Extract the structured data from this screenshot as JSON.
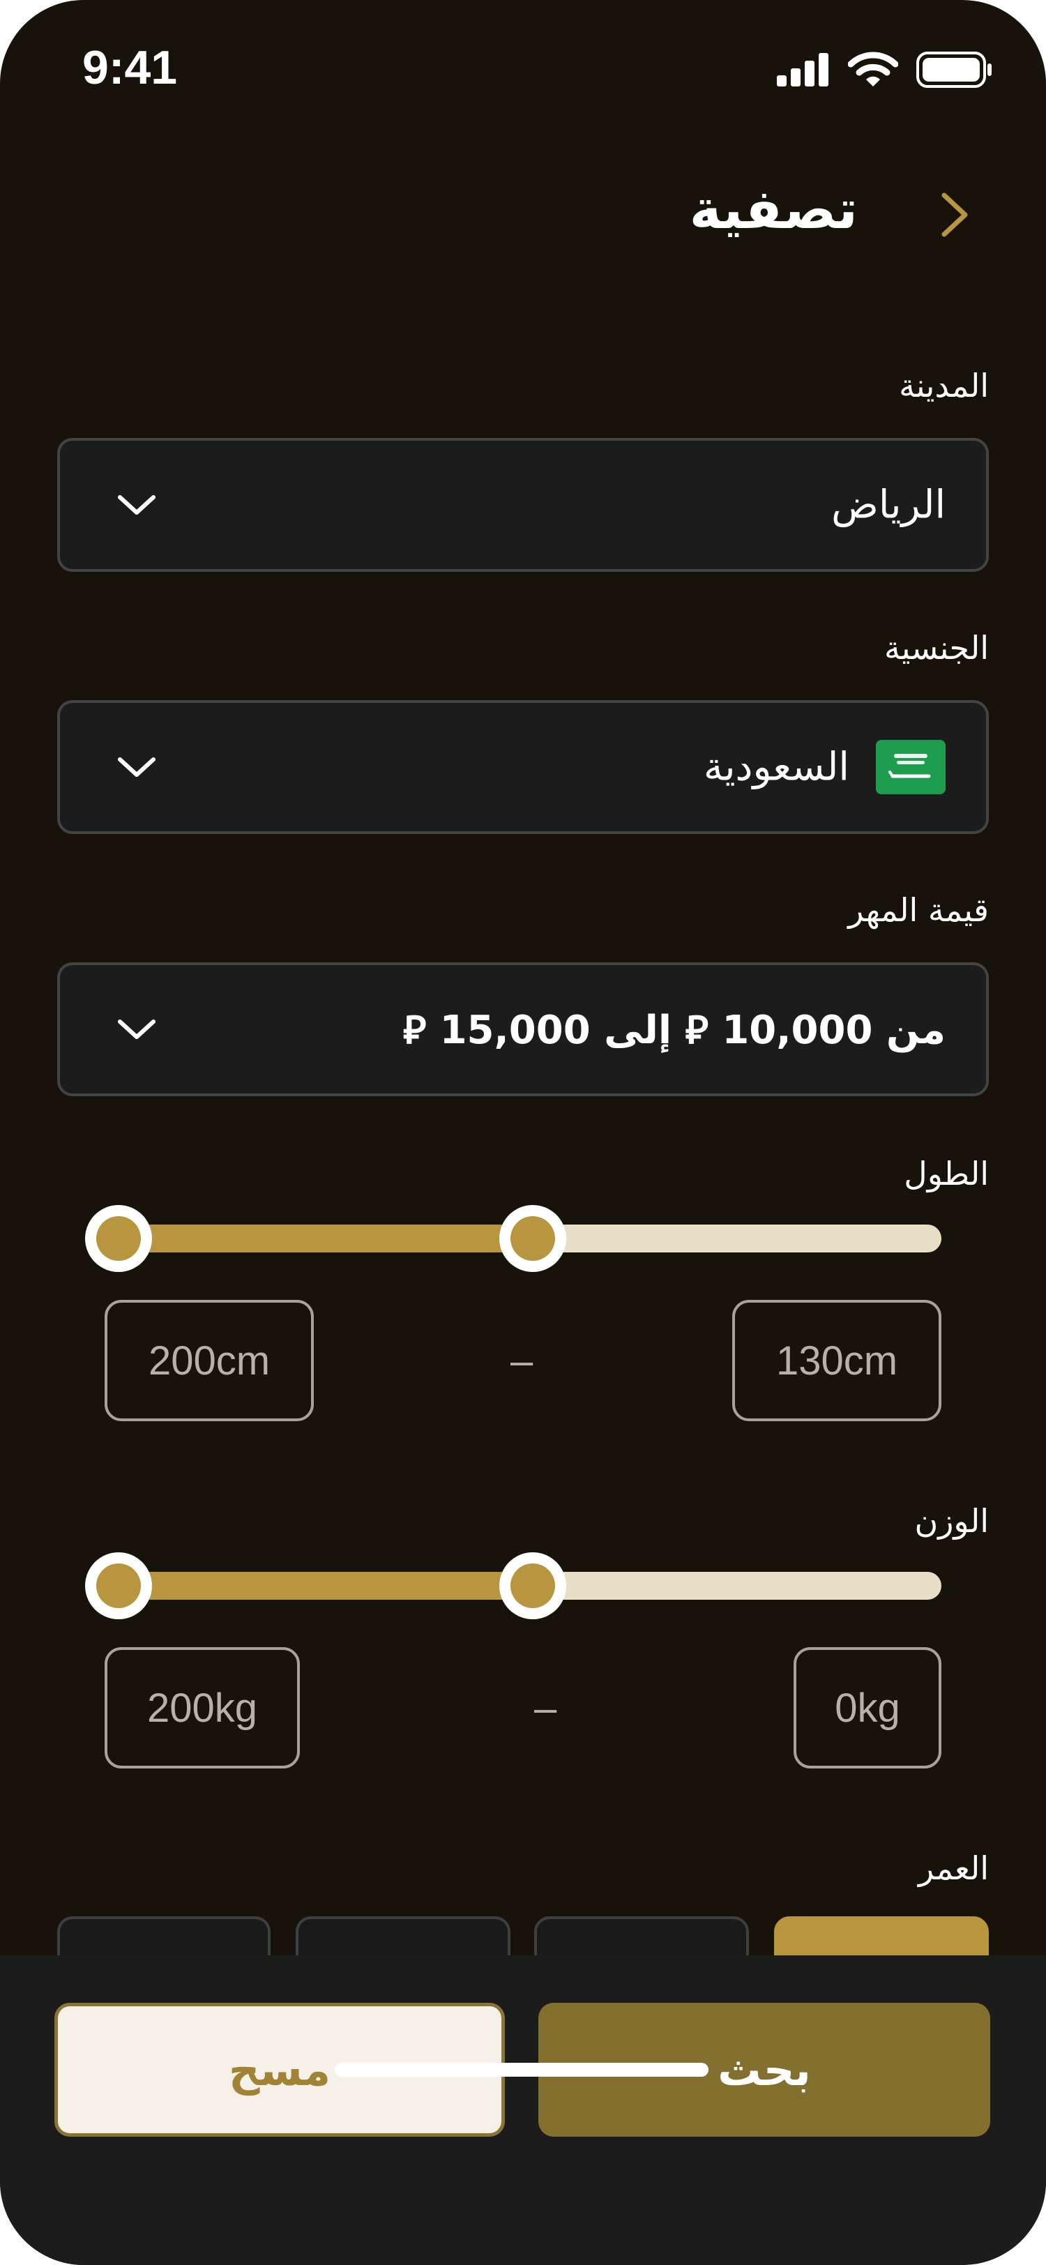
{
  "status_bar": {
    "time": "9:41"
  },
  "header": {
    "title": "تصفية"
  },
  "city": {
    "label": "المدينة",
    "value": "الرياض"
  },
  "nationality": {
    "label": "الجنسية",
    "value": "السعودية"
  },
  "dowry": {
    "label": "قيمة المهر",
    "value": "من 10,000 ⃁  إلى 15,000 ⃁"
  },
  "height": {
    "label": "الطول",
    "min": "130cm",
    "max": "200cm",
    "separator": "–",
    "range_fraction": [
      0.0,
      0.5
    ]
  },
  "weight": {
    "label": "الوزن",
    "min": "0kg",
    "max": "200kg",
    "separator": "–",
    "range_fraction": [
      0.0,
      0.5
    ]
  },
  "age": {
    "label": "العمر"
  },
  "actions": {
    "clear": "مسح",
    "search": "بحث"
  },
  "colors": {
    "background": "#17130a",
    "accent": "#b8963f",
    "button_primary": "#83702e"
  },
  "icons": [
    "signal-icon",
    "wifi-icon",
    "battery-icon",
    "chevron-right-icon",
    "chevron-down-icon",
    "saudi-flag-icon"
  ]
}
